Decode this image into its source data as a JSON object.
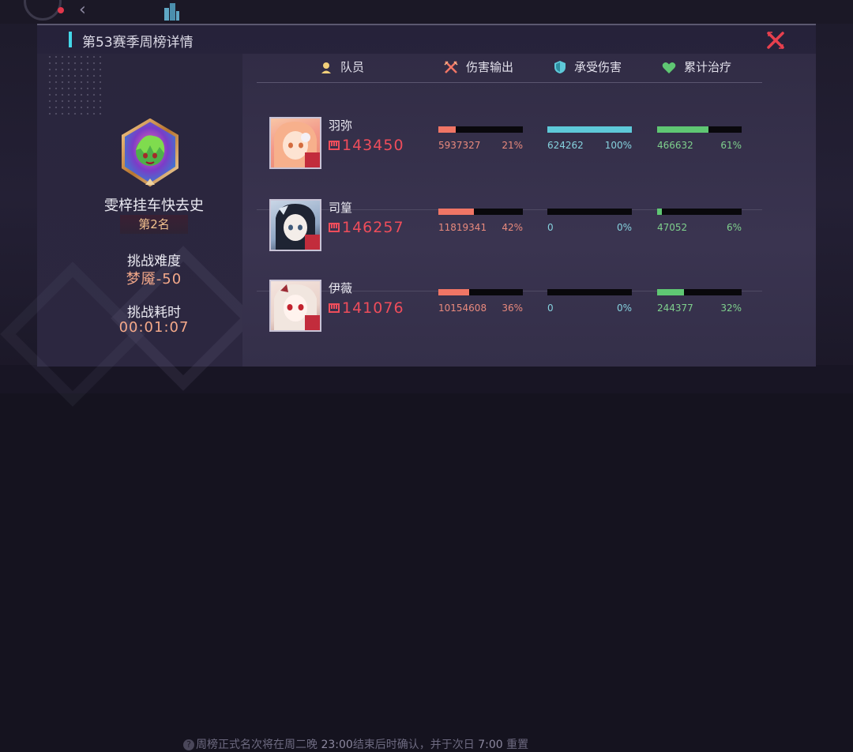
{
  "modal": {
    "title": "第53赛季周榜详情",
    "close_icon": "close-x-icon"
  },
  "profile": {
    "player_name": "雯梓挂车快去史",
    "rank": "第2名",
    "difficulty_label": "挑战难度",
    "difficulty_value": "梦魇-50",
    "time_label": "挑战耗时",
    "time_value": "00:01:07"
  },
  "table": {
    "headers": {
      "member": "队员",
      "damage": "伤害输出",
      "taken": "承受伤害",
      "heal": "累计治疗"
    },
    "rows": [
      {
        "name": "羽弥",
        "power": "143450",
        "damage": "5937327",
        "damage_pct": "21%",
        "damage_frac": 0.21,
        "taken": "624262",
        "taken_pct": "100%",
        "taken_frac": 1.0,
        "heal": "466632",
        "heal_pct": "61%",
        "heal_frac": 0.61
      },
      {
        "name": "司篁",
        "power": "146257",
        "damage": "11819341",
        "damage_pct": "42%",
        "damage_frac": 0.42,
        "taken": "0",
        "taken_pct": "0%",
        "taken_frac": 0,
        "heal": "47052",
        "heal_pct": "6%",
        "heal_frac": 0.06
      },
      {
        "name": "伊薇",
        "power": "141076",
        "damage": "10154608",
        "damage_pct": "36%",
        "damage_frac": 0.36,
        "taken": "0",
        "taken_pct": "0%",
        "taken_frac": 0,
        "heal": "244377",
        "heal_pct": "32%",
        "heal_frac": 0.32
      }
    ]
  },
  "footer_notice": {
    "text_a": "周榜正式名次将在周二晚 ",
    "time_a": "23:00",
    "text_b": "结束后时确认，并于次日 ",
    "time_b": "7:00",
    "text_c": " 重置"
  },
  "colors": {
    "damage": "#f07565",
    "taken": "#5ec9d9",
    "heal": "#5fc773",
    "accent": "#44d7e8",
    "power": "#ef4d5b",
    "rank": "#f2c28f"
  }
}
